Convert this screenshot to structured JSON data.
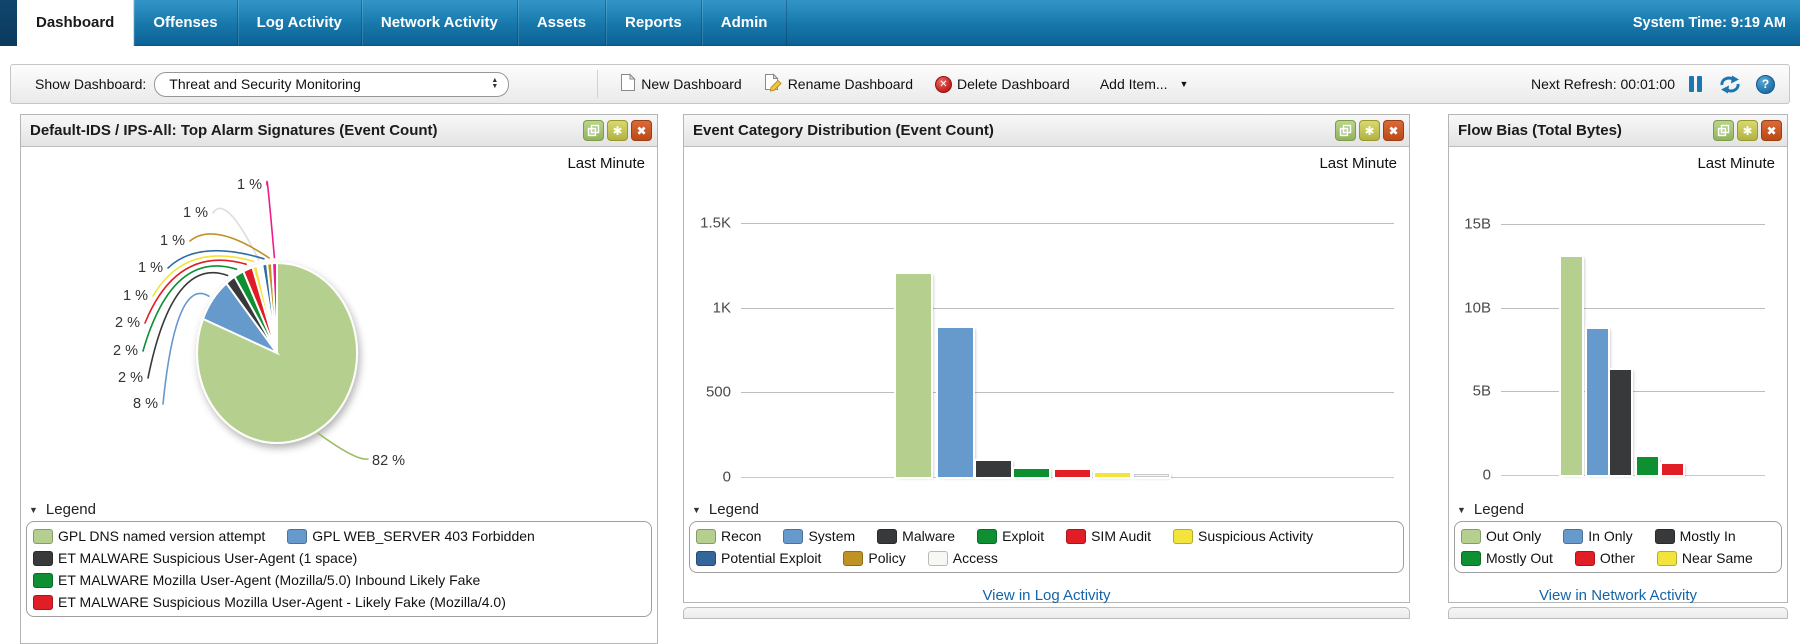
{
  "nav": {
    "tabs": [
      {
        "label": "Dashboard",
        "active": true
      },
      {
        "label": "Offenses",
        "active": false
      },
      {
        "label": "Log Activity",
        "active": false
      },
      {
        "label": "Network Activity",
        "active": false
      },
      {
        "label": "Assets",
        "active": false
      },
      {
        "label": "Reports",
        "active": false
      },
      {
        "label": "Admin",
        "active": false
      }
    ],
    "system_time": "System Time: 9:19 AM"
  },
  "toolbar": {
    "show_dashboard_label": "Show Dashboard:",
    "dashboard_select_value": "Threat and Security Monitoring",
    "new_dashboard_label": "New Dashboard",
    "rename_dashboard_label": "Rename Dashboard",
    "delete_dashboard_label": "Delete Dashboard",
    "add_item_label": "Add Item...",
    "next_refresh_label": "Next Refresh: 00:01:00"
  },
  "icons": {
    "select_arrow_up": "▲",
    "select_arrow_down": "▼",
    "add_item_caret": "▼",
    "legend_caret": "▼",
    "delete_glyph": "✕",
    "close_glyph": "✖",
    "gear_glyph": "✱",
    "help_glyph": "?"
  },
  "panels": [
    {
      "legend_title": "Legend",
      "link": ""
    },
    {
      "legend_title": "Legend",
      "link": "View in Log Activity"
    },
    {
      "legend_title": "Legend",
      "link": "View in Network Activity"
    }
  ],
  "chart_data": [
    {
      "type": "pie",
      "title": "Default-IDS / IPS-All: Top Alarm Signatures (Event Count)",
      "timerange": "Last Minute",
      "slices": [
        {
          "name": "GPL DNS named version attempt",
          "pct": 82,
          "color": "#b5cf8e"
        },
        {
          "name": "GPL WEB_SERVER 403 Forbidden",
          "pct": 8,
          "color": "#6699cc"
        },
        {
          "name": "ET MALWARE Suspicious User-Agent (1 space)",
          "pct": 2,
          "color": "#37393b"
        },
        {
          "name": "ET MALWARE Mozilla User-Agent (Mozilla/5.0) Inbound Likely Fake",
          "pct": 2,
          "color": "#0d8f32"
        },
        {
          "name": "ET MALWARE Suspicious Mozilla User-Agent - Likely Fake (Mozilla/4.0)",
          "pct": 2,
          "color": "#e11d26"
        },
        {
          "name": "",
          "pct": 1,
          "color": "#f2e43c"
        },
        {
          "name": "",
          "pct": 1,
          "color": "#fdfdfd"
        },
        {
          "name": "",
          "pct": 1,
          "color": "#2e6da4"
        },
        {
          "name": "",
          "pct": 1,
          "color": "#bf9224"
        },
        {
          "name": "",
          "pct": 1,
          "color": "#ef1a8e"
        }
      ],
      "callouts": [
        {
          "text": "1 %",
          "color": "#ef1a8e"
        },
        {
          "text": "1 %",
          "color": "#dddddd"
        },
        {
          "text": "1 %",
          "color": "#bf9224"
        },
        {
          "text": "1 %",
          "color": "#2e6da4"
        },
        {
          "text": "1 %",
          "color": "#f2e43c"
        },
        {
          "text": "2 %",
          "color": "#e11d26"
        },
        {
          "text": "2 %",
          "color": "#0d8f32"
        },
        {
          "text": "2 %",
          "color": "#37393b"
        },
        {
          "text": "8 %",
          "color": "#6699cc"
        },
        {
          "text": "82 %",
          "color": "#9cbf6a"
        }
      ],
      "legend_rows": [
        [
          {
            "label": "GPL DNS named version attempt",
            "color": "#b5cf8e"
          },
          {
            "label": "GPL WEB_SERVER 403 Forbidden",
            "color": "#6699cc"
          }
        ],
        [
          {
            "label": "ET MALWARE Suspicious User-Agent (1 space)",
            "color": "#37393b"
          }
        ],
        [
          {
            "label": "ET MALWARE Mozilla User-Agent (Mozilla/5.0) Inbound Likely Fake",
            "color": "#0d8f32"
          }
        ],
        [
          {
            "label": "ET MALWARE Suspicious Mozilla User-Agent - Likely Fake (Mozilla/4.0)",
            "color": "#e11d26"
          }
        ]
      ]
    },
    {
      "type": "bar",
      "title": "Event Category Distribution (Event Count)",
      "timerange": "Last Minute",
      "ymax": 1500,
      "yticks": [
        "1.5K",
        "1K",
        "500",
        "0"
      ],
      "bars": [
        {
          "name": "Recon",
          "value": 1200,
          "color": "#b5cf8e"
        },
        {
          "name": "System",
          "value": 880,
          "color": "#6699cc"
        },
        {
          "name": "Malware",
          "value": 95,
          "color": "#37393b"
        },
        {
          "name": "Exploit",
          "value": 48,
          "color": "#0d8f32"
        },
        {
          "name": "SIM Audit",
          "value": 40,
          "color": "#e11d26"
        },
        {
          "name": "Suspicious Activity",
          "value": 25,
          "color": "#f2e43c"
        },
        {
          "name": "Access",
          "value": 18,
          "color": "#f7f7f4",
          "border": "#c9c9c9"
        }
      ],
      "legend_rows": [
        [
          {
            "label": "Recon",
            "color": "#b5cf8e"
          },
          {
            "label": "System",
            "color": "#6699cc"
          },
          {
            "label": "Malware",
            "color": "#37393b"
          },
          {
            "label": "Exploit",
            "color": "#0d8f32"
          },
          {
            "label": "SIM Audit",
            "color": "#e11d26"
          },
          {
            "label": "Suspicious Activity",
            "color": "#f2e43c"
          }
        ],
        [
          {
            "label": "Potential Exploit",
            "color": "#336699"
          },
          {
            "label": "Policy",
            "color": "#bf9224"
          },
          {
            "label": "Access",
            "color": "#f7f7f4"
          }
        ]
      ],
      "link": "View in Log Activity"
    },
    {
      "type": "bar",
      "title": "Flow Bias (Total Bytes)",
      "timerange": "Last Minute",
      "ymax": 15,
      "unit": "B",
      "yticks": [
        "15B",
        "10B",
        "5B",
        "0"
      ],
      "bars": [
        {
          "name": "Out Only",
          "value": 13,
          "color": "#b5cf8e"
        },
        {
          "name": "In Only",
          "value": 8.7,
          "color": "#6699cc"
        },
        {
          "name": "Mostly In",
          "value": 6.3,
          "color": "#37393b"
        },
        {
          "name": "Mostly Out",
          "value": 1.1,
          "color": "#0d8f32"
        },
        {
          "name": "Other",
          "value": 0.65,
          "color": "#e11d26"
        }
      ],
      "legend_rows": [
        [
          {
            "label": "Out Only",
            "color": "#b5cf8e"
          },
          {
            "label": "In Only",
            "color": "#6699cc"
          },
          {
            "label": "Mostly In",
            "color": "#37393b"
          }
        ],
        [
          {
            "label": "Mostly Out",
            "color": "#0d8f32"
          },
          {
            "label": "Other",
            "color": "#e11d26"
          },
          {
            "label": "Near Same",
            "color": "#f2e43c"
          }
        ]
      ],
      "link": "View in Network Activity"
    }
  ]
}
